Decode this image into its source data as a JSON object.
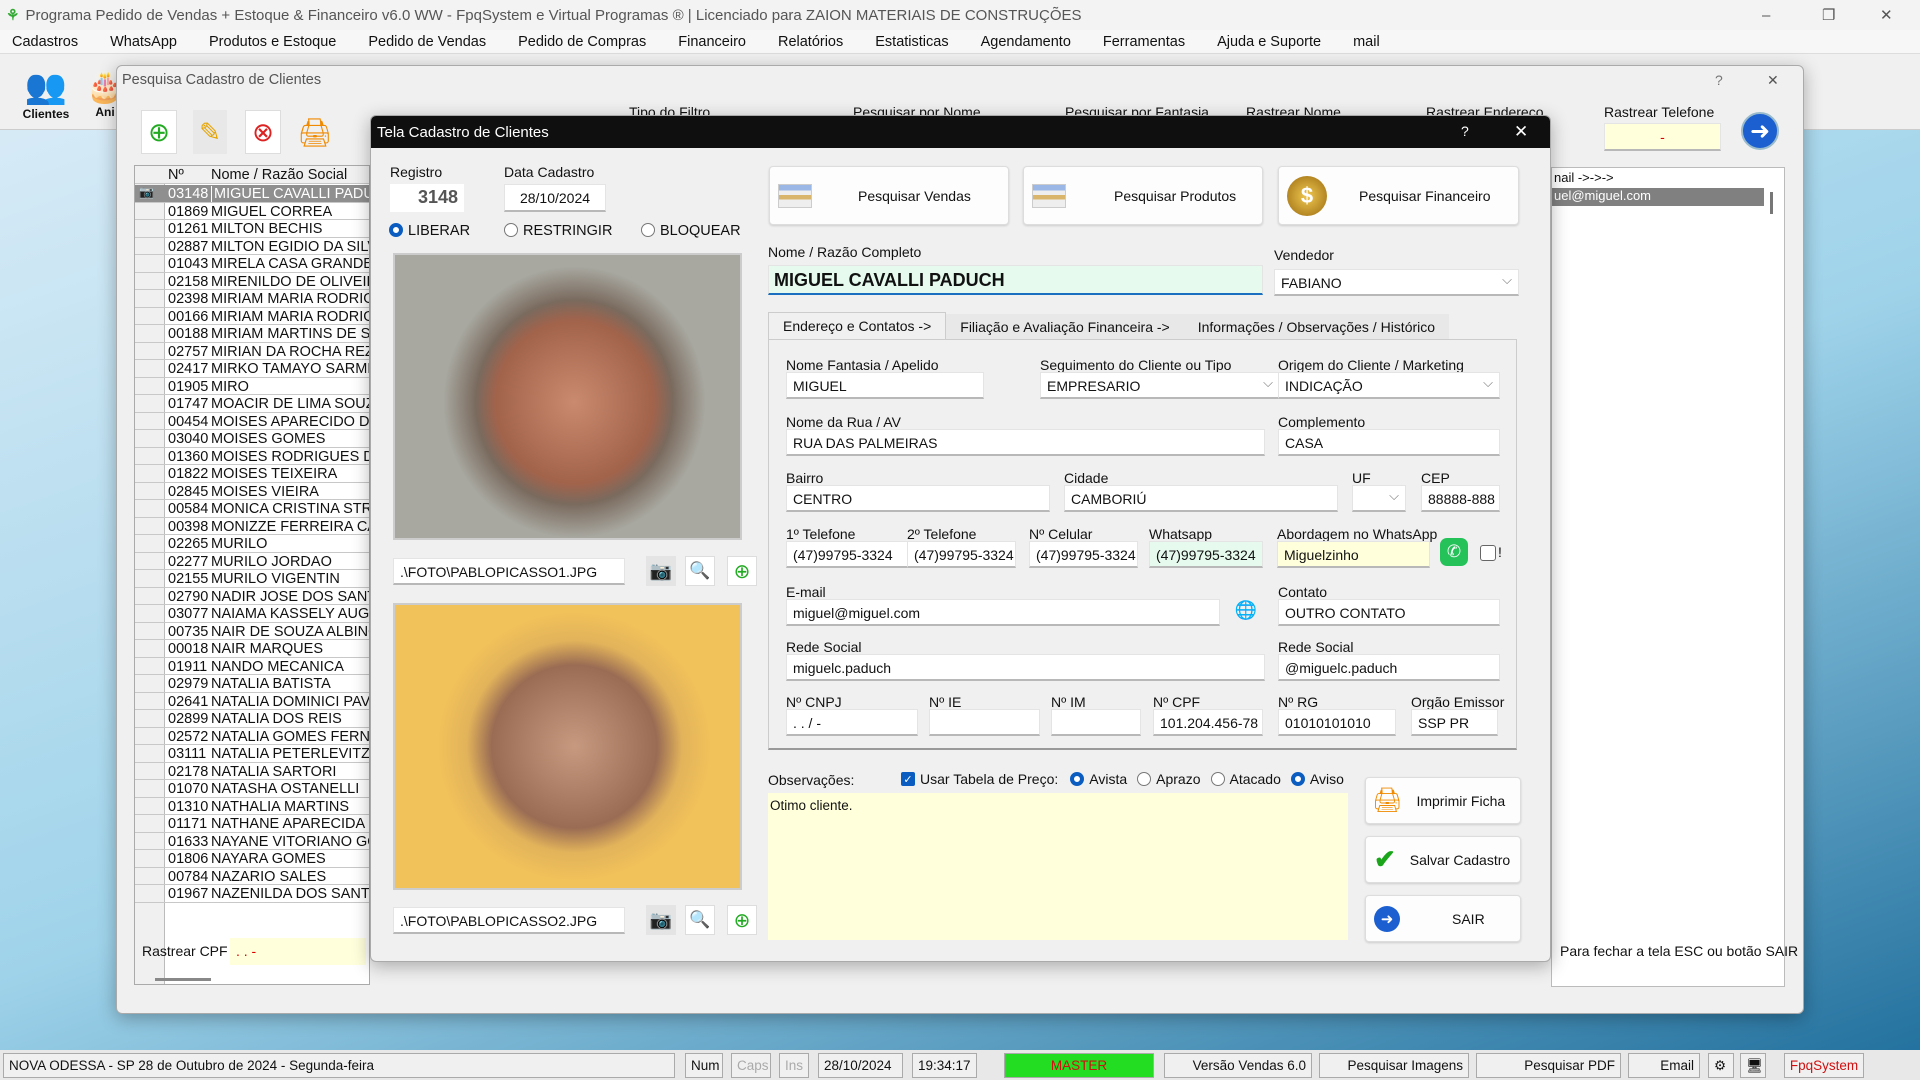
{
  "app": {
    "title": "Programa Pedido de Vendas + Estoque & Financeiro v6.0 WW - FpqSystem e Virtual Programas ® | Licenciado para  ZAION MATERIAIS DE CONSTRUÇÕES",
    "minimize": "–",
    "maximize": "❐",
    "close": "✕"
  },
  "menu": [
    "Cadastros",
    "WhatsApp",
    "Produtos e Estoque",
    "Pedido de Vendas",
    "Pedido de Compras",
    "Financeiro",
    "Relatórios",
    "Estatisticas",
    "Agendamento",
    "Ferramentas",
    "Ajuda e Suporte",
    "mail"
  ],
  "toolbar": {
    "clientes": "Clientes",
    "ani": "Ani"
  },
  "search_window": {
    "title": "Pesquisa Cadastro de Clientes",
    "help": "?",
    "close": "✕",
    "filters": {
      "tipo": "Tipo do Filtro",
      "nome": "Pesquisar por Nome",
      "fantasia": "Pesquisar por Fantasia",
      "rastrear_nome": "Rastrear Nome",
      "rastrear_endereco": "Rastrear Endereco",
      "rastrear_telefone": "Rastrear Telefone",
      "telefone_value": "-"
    },
    "columns": [
      "Nº",
      "Nome / Razão Social"
    ],
    "rows": [
      [
        "03148",
        "MIGUEL CAVALLI PADUCH"
      ],
      [
        "01869",
        "MIGUEL CORREA"
      ],
      [
        "01261",
        "MILTON BECHIS"
      ],
      [
        "02887",
        "MILTON EGIDIO DA SILVA"
      ],
      [
        "01043",
        "MIRELA CASA GRANDE F"
      ],
      [
        "02158",
        "MIRENILDO DE OLIVEIRA"
      ],
      [
        "02398",
        "MIRIAM MARIA RODRIGU"
      ],
      [
        "00166",
        "MIRIAM MARIA RODRIGU"
      ],
      [
        "00188",
        "MIRIAM MARTINS DE SO"
      ],
      [
        "02757",
        "MIRIAN DA ROCHA REZE"
      ],
      [
        "02417",
        "MIRKO TAMAYO SARMIE"
      ],
      [
        "01905",
        "MIRO"
      ],
      [
        "01747",
        "MOACIR DE LIMA SOUZA"
      ],
      [
        "00454",
        "MOISES APARECIDO DE"
      ],
      [
        "03040",
        "MOISES GOMES"
      ],
      [
        "01360",
        "MOISES RODRIGUES DE"
      ],
      [
        "01822",
        "MOISES TEIXEIRA"
      ],
      [
        "02845",
        "MOISES VIEIRA"
      ],
      [
        "00584",
        "MONICA CRISTINA STRA"
      ],
      [
        "00398",
        "MONIZZE FERREIRA CAV"
      ],
      [
        "02265",
        "MURILO"
      ],
      [
        "02277",
        "MURILO JORDAO"
      ],
      [
        "02155",
        "MURILO VIGENTIN"
      ],
      [
        "02790",
        "NADIR JOSE DOS SANTO"
      ],
      [
        "03077",
        "NAIAMA KASSELY AUGUS"
      ],
      [
        "00735",
        "NAIR DE SOUZA ALBINO"
      ],
      [
        "00018",
        "NAIR MARQUES"
      ],
      [
        "01911",
        "NANDO MECANICA"
      ],
      [
        "02979",
        "NATALIA  BATISTA"
      ],
      [
        "02641",
        "NATALIA DOMINICI PAVA"
      ],
      [
        "02899",
        "NATALIA DOS REIS"
      ],
      [
        "02572",
        "NATALIA GOMES FERNAN"
      ],
      [
        "03111",
        "NATALIA PETERLEVITZ F"
      ],
      [
        "02178",
        "NATALIA SARTORI"
      ],
      [
        "01070",
        "NATASHA OSTANELLI"
      ],
      [
        "01310",
        "NATHALIA MARTINS"
      ],
      [
        "01171",
        "NATHANE APARECIDA M"
      ],
      [
        "01633",
        "NAYANE VITORIANO GO"
      ],
      [
        "01806",
        "NAYARA GOMES"
      ],
      [
        "00784",
        "NAZARIO SALES"
      ],
      [
        "01967",
        "NAZENILDA DOS SANTO"
      ]
    ],
    "right_header": "nail ->->->",
    "right_selected": "uel@miguel.com",
    "rastrear_cpf": "Rastrear CPF",
    "cpf_value": "  .   .   -",
    "hint": "Para fechar a tela ESC ou botão SAIR"
  },
  "dialog": {
    "title": "Tela Cadastro de Clientes",
    "help": "?",
    "close": "✕",
    "registro_label": "Registro",
    "registro": "3148",
    "data_label": "Data Cadastro",
    "data": "28/10/2024",
    "status": [
      {
        "label": "LIBERAR",
        "checked": true
      },
      {
        "label": "RESTRINGIR",
        "checked": false
      },
      {
        "label": "BLOQUEAR",
        "checked": false
      }
    ],
    "photo1_path": ".\\FOTO\\PABLOPICASSO1.JPG",
    "photo2_path": ".\\FOTO\\PABLOPICASSO2.JPG",
    "btn_vendas": "Pesquisar Vendas",
    "btn_produtos": "Pesquisar Produtos",
    "btn_financeiro": "Pesquisar  Financeiro",
    "nome_label": "Nome / Razão Completo",
    "nome": "MIGUEL CAVALLI PADUCH",
    "vendedor_label": "Vendedor",
    "vendedor": "FABIANO",
    "tabs": [
      "Endereço e Contatos  ->",
      "Filiação e Avaliação Financeira  ->",
      "Informações / Observações / Histórico"
    ],
    "fields": {
      "fantasia_l": "Nome Fantasia / Apelido",
      "fantasia": "MIGUEL",
      "seg_l": "Seguimento do Cliente ou Tipo",
      "seg": "EMPRESARIO",
      "origem_l": "Origem do Cliente / Marketing",
      "origem": "INDICAÇÃO",
      "rua_l": "Nome da Rua / AV",
      "rua": "RUA DAS PALMEIRAS",
      "comp_l": "Complemento",
      "comp": "CASA",
      "bairro_l": "Bairro",
      "bairro": "CENTRO",
      "cidade_l": "Cidade",
      "cidade": "CAMBORIÚ",
      "uf_l": "UF",
      "uf": "",
      "cep_l": "CEP",
      "cep": "88888-888",
      "tel1_l": "1º Telefone",
      "tel1": "(47)99795-3324",
      "tel2_l": "2º Telefone",
      "tel2": "(47)99795-3324",
      "cel_l": "Nº Celular",
      "cel": "(47)99795-3324",
      "wa_l": "Whatsapp",
      "wa": "(47)99795-3324",
      "abord_l": "Abordagem no WhatsApp",
      "abord": "Miguelzinho",
      "excl": "!",
      "email_l": "E-mail",
      "email": "miguel@miguel.com",
      "contato_l": "Contato",
      "contato": "OUTRO CONTATO",
      "rede1_l": "Rede Social",
      "rede1": "miguelc.paduch",
      "rede2_l": "Rede Social",
      "rede2": "@miguelc.paduch",
      "cnpj_l": "Nº CNPJ",
      "cnpj": "  .   .   /    -",
      "ie_l": "Nº IE",
      "ie": "",
      "im_l": "Nº IM",
      "im": "",
      "cpf_l": "Nº CPF",
      "cpf": "101.204.456-78",
      "rg_l": "Nº RG",
      "rg": "01010101010",
      "orgao_l": "Orgão Emissor",
      "orgao": "SSP PR"
    },
    "obs_label": "Observações:",
    "usar_tabela": "Usar Tabela de Preço:",
    "price": [
      {
        "label": "Avista",
        "checked": true
      },
      {
        "label": "Aprazo",
        "checked": false
      },
      {
        "label": "Atacado",
        "checked": false
      },
      {
        "label": "Aviso",
        "checked": true
      }
    ],
    "obs": "Otimo cliente.",
    "btn_imprimir": "Imprimir Ficha",
    "btn_salvar": "Salvar Cadastro",
    "btn_sair": "SAIR"
  },
  "status": {
    "location": "NOVA ODESSA - SP 28 de Outubro de 2024 - Segunda-feira",
    "num": "Num",
    "caps": "Caps",
    "ins": "Ins",
    "date": "28/10/2024",
    "time": "19:34:17",
    "user": "MASTER",
    "versao": "Versão Vendas 6.0",
    "imagens": "Pesquisar Imagens",
    "pdf": "Pesquisar PDF",
    "email": "Email",
    "brand": "FpqSystem"
  },
  "colors": {
    "accent": "#0b5cc0",
    "name_bg": "#e6fbee",
    "note_bg": "#ffffdc",
    "master_bg": "#22dd22",
    "brand": "#d01010"
  }
}
